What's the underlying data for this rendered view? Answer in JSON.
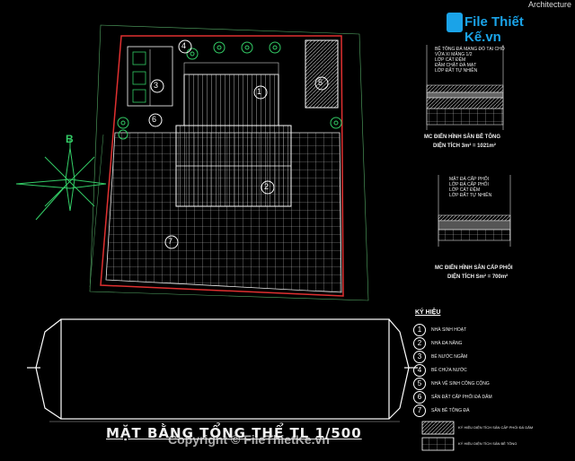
{
  "header": {
    "app_label": "Architecture"
  },
  "watermark": {
    "brand": "File Thiết Kế.vn",
    "copyright": "Copyright © FileThietKe.vn"
  },
  "plan": {
    "north_label": "B",
    "building_numbers": [
      "1",
      "2",
      "3",
      "4",
      "5",
      "6",
      "7"
    ]
  },
  "sections": [
    {
      "title": "MC ĐIỂN HÌNH SÂN BÊ TÔNG",
      "area": "DIỆN TÍCH 3m² = 1021m²",
      "layers": [
        "BÊ TÔNG ĐÁ MẠNG ĐỔ TẠI CHỖ",
        "VỮA XI MĂNG 1/2",
        "LỚP CÁT ĐỆM",
        "ĐẦM CHẶT ĐÁ MẠT",
        "LỚP ĐẤT TỰ NHIÊN"
      ]
    },
    {
      "title": "MC ĐIỂN HÌNH SÂN CẤP PHỐI",
      "area": "DIỆN TÍCH Sm² = 700m²",
      "layers": [
        "MẶT ĐÁ CẤP PHỐI",
        "LỚP ĐÁ CẤP PHỐI",
        "LỚP CÁT ĐỆM",
        "LỚP ĐẤT TỰ NHIÊN"
      ]
    }
  ],
  "legend": {
    "title": "KÝ HIỆU",
    "items": [
      {
        "num": "1",
        "label": "NHÀ SINH HOẠT"
      },
      {
        "num": "2",
        "label": "NHÀ ĐA NĂNG"
      },
      {
        "num": "3",
        "label": "BỂ NƯỚC NGẦM"
      },
      {
        "num": "4",
        "label": "BỂ CHỨA NƯỚC"
      },
      {
        "num": "5",
        "label": "NHÀ VỆ SINH CÔNG CỘNG"
      },
      {
        "num": "6",
        "label": "SÂN ĐẶT CẤP PHỐI ĐÁ DĂM"
      },
      {
        "num": "7",
        "label": "SÂN BÊ TÔNG ĐÁ"
      }
    ],
    "swatch_labels": [
      "KÝ HIỆU DIỆN TÍCH SÂN CẤP PHỐI ĐÁ DĂM",
      "KÝ HIỆU DIỆN TÍCH SÂN BÊ TÔNG"
    ]
  },
  "drawing_title": "MẶT BẰNG TỔNG THỂ TL 1/500"
}
